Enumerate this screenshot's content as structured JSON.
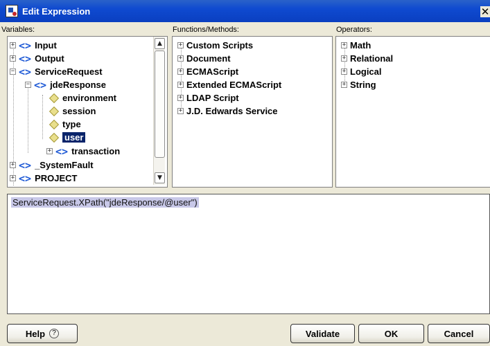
{
  "window": {
    "title": "Edit Expression",
    "close_glyph": "✕"
  },
  "variables": {
    "label": "Variables:",
    "items": [
      {
        "label": "Input",
        "icon": "xml-tag-icon"
      },
      {
        "label": "Output",
        "icon": "xml-tag-icon"
      },
      {
        "label": "ServiceRequest",
        "icon": "xml-tag-icon"
      },
      {
        "label": "jdeResponse",
        "icon": "xml-tag-icon"
      },
      {
        "label": "environment",
        "icon": "attribute-diamond-icon"
      },
      {
        "label": "session",
        "icon": "attribute-diamond-icon"
      },
      {
        "label": "type",
        "icon": "attribute-diamond-icon"
      },
      {
        "label": "user",
        "icon": "attribute-diamond-icon"
      },
      {
        "label": "transaction",
        "icon": "xml-tag-icon"
      },
      {
        "label": "_SystemFault",
        "icon": "xml-tag-icon"
      },
      {
        "label": "PROJECT",
        "icon": "xml-tag-icon"
      }
    ]
  },
  "functions": {
    "label": "Functions/Methods:",
    "items": [
      "Custom Scripts",
      "Document",
      "ECMAScript",
      "Extended ECMAScript",
      "LDAP Script",
      "J.D. Edwards Service"
    ]
  },
  "operators": {
    "label": "Operators:",
    "items": [
      "Math",
      "Relational",
      "Logical",
      "String"
    ]
  },
  "editor": {
    "expression": "ServiceRequest.XPath(\"jdeResponse/@user\")"
  },
  "buttons": {
    "help": "Help",
    "validate": "Validate",
    "ok": "OK",
    "cancel": "Cancel"
  }
}
